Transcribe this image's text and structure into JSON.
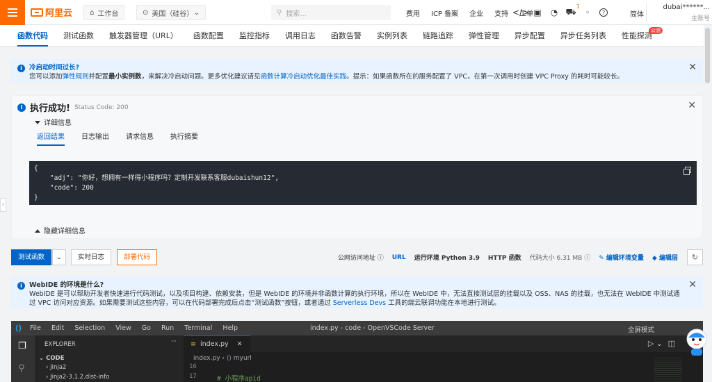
{
  "topbar": {
    "brand": "阿里云",
    "workbench": "工作台",
    "region": "美国（硅谷）",
    "search_placeholder": "搜索...",
    "links": [
      "费用",
      "ICP 备案",
      "企业",
      "支持",
      "工单"
    ],
    "cart_badge": "1",
    "lang": "简体",
    "user": "dubai******...",
    "account": "主账号"
  },
  "tabs": [
    {
      "label": "函数代码",
      "active": true
    },
    {
      "label": "测试函数"
    },
    {
      "label": "触发器管理（URL）"
    },
    {
      "label": "函数配置"
    },
    {
      "label": "监控指标"
    },
    {
      "label": "调用日志"
    },
    {
      "label": "函数告警"
    },
    {
      "label": "实例列表"
    },
    {
      "label": "链路追踪"
    },
    {
      "label": "弹性管理"
    },
    {
      "label": "异步配置"
    },
    {
      "label": "异步任务列表"
    },
    {
      "label": "性能探测",
      "badge": "公测"
    }
  ],
  "notice1": {
    "title": "冷启动时间过长?",
    "p1": "您可以添加",
    "link1": "弹性规则",
    "p2": "并配置",
    "bold1": "最小实例数",
    "p3": "，来解决冷启动问题。更多优化建议请见",
    "link2": "函数计算冷启动优化最佳实践",
    "p4": "。提示：如果函数所在的服务配置了 VPC，在第一次调用时创建 VPC Proxy 的耗时可能较长。"
  },
  "result": {
    "title": "执行成功!",
    "status": "Status Code: 200",
    "detail_label": "详细信息",
    "subtabs": [
      "返回结果",
      "日志输出",
      "请求信息",
      "执行摘要"
    ],
    "code_lines": [
      "{",
      "    \"adj\": \"你好，想拥有一样得小程序吗？定制开发联系客服dubaishun12\",",
      "    \"code\": 200",
      "}"
    ],
    "hide_label": "隐藏详细信息"
  },
  "actions": {
    "test": "测试函数",
    "log": "实时日志",
    "deploy": "部署代码",
    "public_url_label": "公网访问地址",
    "url": "URL",
    "runtime": "运行环境 Python 3.9",
    "http": "HTTP 函数",
    "size": "代码大小 6.31 MB",
    "edit_env": "编辑环境变量",
    "edit_layer": "编辑层"
  },
  "notice2": {
    "title": "WebIDE 的环境是什么?",
    "text": "WebIDE 是可以帮助开发者快速进行代码测试，以及项目构建、依赖安装，但是 WebIDE 的环境并非函数计算的执行环境，所以在 WebIDE 中，无法直接测试层的挂载以及 OSS、NAS 的挂载，也无法在 WebIDE 中测试通过 VPC 访问对应资源。如果需要测试这些内容，可以在代码部署完成后点击“测试函数”按钮，或者通过 ",
    "link": "Serverless Devs",
    "tail": " 工具的端云联调功能在本地进行测试。"
  },
  "vscode": {
    "menu": [
      "File",
      "Edit",
      "Selection",
      "View",
      "Go",
      "Run",
      "Terminal",
      "Help"
    ],
    "title": "index.py - code - OpenVSCode Server",
    "fullscreen": "全屏模式",
    "explorer": "EXPLORER",
    "code_folder": "CODE",
    "tree": [
      "Jinja2",
      "Jinja2-3.1.2.dist-info"
    ],
    "tab": "index.py",
    "crumb_file": "index.py",
    "crumb_symbol": "myurl",
    "line16": "16",
    "line17": "17",
    "line17_text": "# 小程序apid"
  }
}
